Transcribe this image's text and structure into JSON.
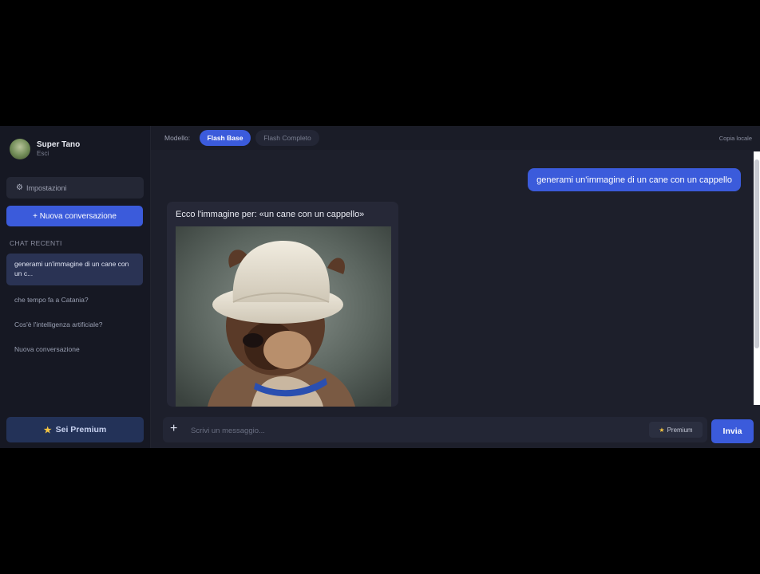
{
  "profile": {
    "name": "Super Tano",
    "logout": "Esci"
  },
  "sidebar": {
    "settings_label": "Impostazioni",
    "new_chat_label": "+ Nuova conversazione",
    "recent_title": "CHAT RECENTI",
    "chats": [
      {
        "label": "generami un'immagine di un cane con un c...",
        "active": true
      },
      {
        "label": "che tempo fa a Catania?",
        "active": false
      },
      {
        "label": "Cos'è l'intelligenza artificiale?",
        "active": false
      },
      {
        "label": "Nuova conversazione",
        "active": false
      }
    ],
    "premium_label": "Sei Premium"
  },
  "topbar": {
    "model_label": "Modello:",
    "models": [
      {
        "label": "Flash Base",
        "selected": true
      },
      {
        "label": "Flash Completo",
        "selected": false
      }
    ],
    "export_label": "Copia locale"
  },
  "messages": {
    "user": "generami un'immagine di un cane con un cappello",
    "bot_text": "Ecco l'immagine per: «un cane con un cappello»"
  },
  "composer": {
    "plus": "+",
    "placeholder": "Scrivi un messaggio...",
    "premium_label": "Premium",
    "send_label": "Invia"
  },
  "colors": {
    "accent": "#3b5bdb",
    "sidebar_bg": "#161823",
    "main_bg": "#1d1f2b",
    "star": "#f5c542"
  }
}
